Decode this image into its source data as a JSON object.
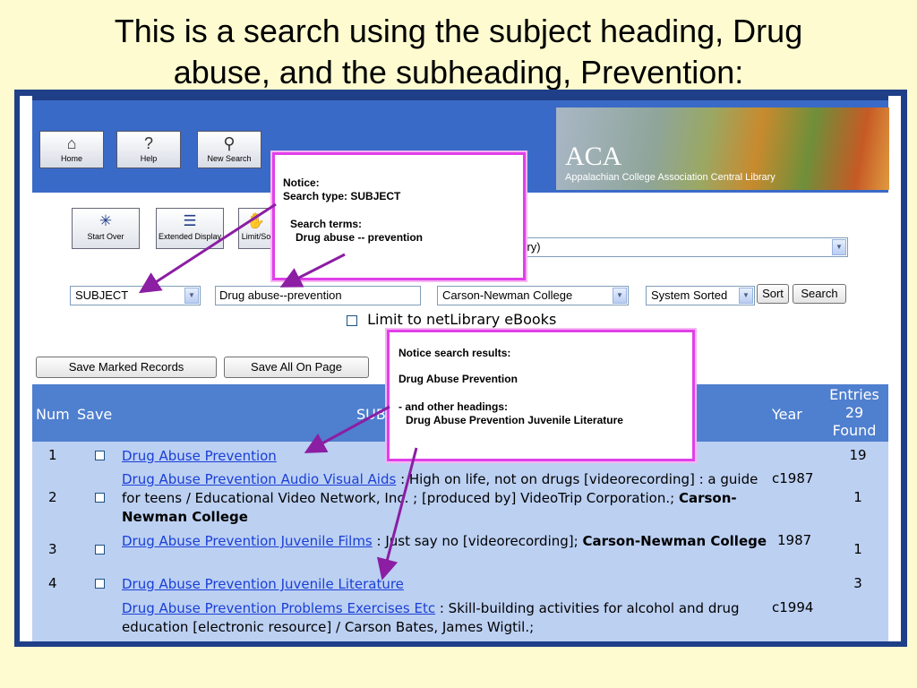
{
  "slide": {
    "title_line1": "This is a search using the subject heading, Drug",
    "title_line2": "abuse, and the subheading, Prevention:"
  },
  "colors": {
    "background": "#fdfbcf",
    "frame": "#1f3f88",
    "header_band": "#3a6ac7",
    "table_header": "#4f7fcf",
    "table_body": "#bcd0f2",
    "link": "#1a3fd6",
    "callout_border": "#e040e8",
    "arrow": "#8b1ea3"
  },
  "nav": {
    "home": {
      "label": "Home",
      "icon": "home-icon"
    },
    "help": {
      "label": "Help",
      "icon": "help-icon"
    },
    "new_search": {
      "label": "New Search",
      "icon": "new-search-icon"
    }
  },
  "banner": {
    "acronym": "ACA",
    "name": "Appalachian College Association Central Library"
  },
  "toolbar": {
    "start_over": "Start Over",
    "extended_display": "Extended Display",
    "limit_sort": "Limit/So"
  },
  "history_select": {
    "value": "n History)"
  },
  "search": {
    "type_value": "SUBJECT",
    "term_value": "Drug abuse--prevention",
    "library_value": "Carson-Newman College",
    "sort_value": "System Sorted",
    "sort_button": "Sort",
    "search_button": "Search",
    "limit_label": "Limit to netLibrary eBooks"
  },
  "actions": {
    "save_marked": "Save Marked Records",
    "save_all": "Save All On Page"
  },
  "table": {
    "col_num": "Num",
    "col_save": "Save",
    "col_subject": "SUB",
    "col_year": "Year",
    "col_entries_1": "Entries",
    "col_entries_2": "29",
    "col_entries_3": "Found",
    "rows": [
      {
        "num": "1",
        "link": "Drug Abuse Prevention",
        "rest": "",
        "bold": "",
        "year": "",
        "count": "19"
      },
      {
        "num": "2",
        "link": "Drug Abuse Prevention Audio Visual Aids",
        "rest": " : High on life, not on drugs [videorecording] : a guide for teens / Educational Video Network, Inc. ; [produced by] VideoTrip Corporation.; ",
        "bold": "Carson-Newman College",
        "year": "c1987",
        "count": "1"
      },
      {
        "num": "3",
        "link": "Drug Abuse Prevention Juvenile Films",
        "rest": " : Just say no [videorecording]; ",
        "bold": "Carson-Newman College",
        "year": "1987",
        "count": "1"
      },
      {
        "num": "4",
        "link": "Drug Abuse Prevention Juvenile Literature",
        "rest": "",
        "bold": "",
        "year": "",
        "count": "3"
      },
      {
        "num": "",
        "link": "Drug Abuse Prevention Problems Exercises Etc",
        "rest": " : Skill-building activities for alcohol and drug education [electronic resource] / Carson Bates, James Wigtil.;",
        "bold": "",
        "year": "c1994",
        "count": ""
      }
    ]
  },
  "callout1": {
    "line1": "Notice:",
    "line2": "Search type:  SUBJECT",
    "line3": "Search terms:",
    "line4": "Drug abuse -- prevention"
  },
  "callout2": {
    "line1": "Notice search results:",
    "line2": "Drug Abuse Prevention",
    "line3": "- and other headings:",
    "line4": "Drug Abuse Prevention Juvenile Literature"
  }
}
